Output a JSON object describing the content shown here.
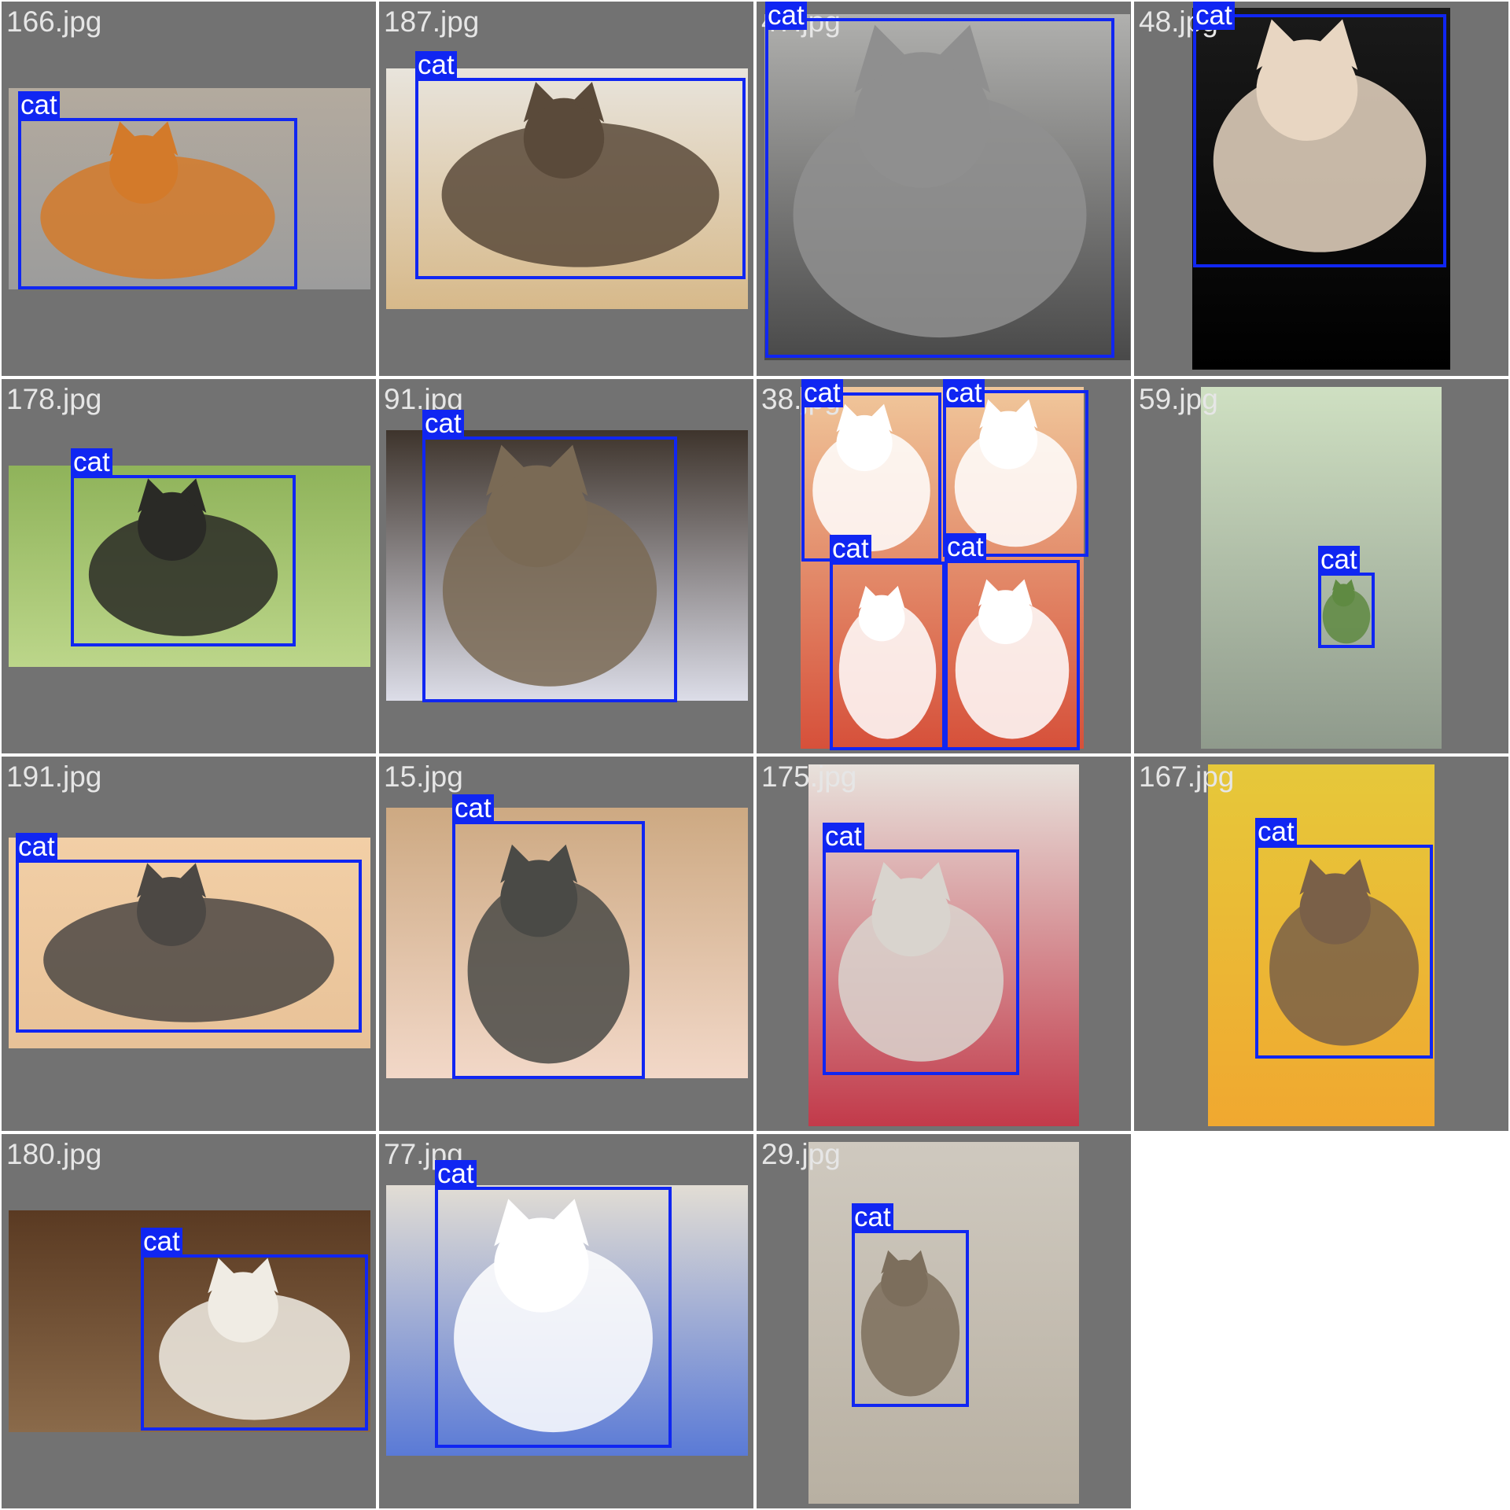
{
  "detection_class": "cat",
  "colors": {
    "tile_background": "#727272",
    "box_and_tag": "#1026f2",
    "tag_text": "#ffffff",
    "filename_text": "#e6e6e6"
  },
  "tiles": [
    {
      "file": "166.jpg",
      "scene": "orange tabby sleeping on grey mat",
      "palette": [
        "#b3aa9e",
        "#d37a2a",
        "#9c9c9c"
      ],
      "detections": [
        {
          "label": "cat"
        }
      ]
    },
    {
      "file": "187.jpg",
      "scene": "tortoiseshell persian lying on wooden floor",
      "palette": [
        "#e8e4dc",
        "#5a4a3a",
        "#d7b98a"
      ],
      "detections": [
        {
          "label": "cat"
        }
      ]
    },
    {
      "file": "47.jpg",
      "scene": "grey and white kitten in a dark hood",
      "palette": [
        "#b0b0ae",
        "#8f8f8f",
        "#494949"
      ],
      "detections": [
        {
          "label": "cat"
        }
      ]
    },
    {
      "file": "48.jpg",
      "scene": "cream kitten held up in hands",
      "palette": [
        "#1a1a1a",
        "#e8d6c2",
        "#000000"
      ],
      "detections": [
        {
          "label": "cat"
        }
      ]
    },
    {
      "file": "178.jpg",
      "scene": "black long-haired cat in grass",
      "palette": [
        "#8fb35a",
        "#2a2a26",
        "#bcd68a"
      ],
      "detections": [
        {
          "label": "cat"
        }
      ]
    },
    {
      "file": "91.jpg",
      "scene": "brown tabby from behind on blanket",
      "palette": [
        "#3e342c",
        "#7a6a55",
        "#dcdde8"
      ],
      "detections": [
        {
          "label": "cat"
        }
      ]
    },
    {
      "file": "38.jpg",
      "scene": "four cat selfies collage",
      "palette": [
        "#f0c79b",
        "#ffffff",
        "#d6503a"
      ],
      "detections": [
        {
          "label": "cat"
        },
        {
          "label": "cat"
        },
        {
          "label": "cat"
        },
        {
          "label": "cat"
        }
      ]
    },
    {
      "file": "59.jpg",
      "scene": "tiny kitten on a tiled roof under leaves",
      "palette": [
        "#cfe0c2",
        "#5f8a42",
        "#8f9a8c"
      ],
      "detections": [
        {
          "label": "cat"
        }
      ]
    },
    {
      "file": "191.jpg",
      "scene": "maine coon lying on beige backdrop",
      "palette": [
        "#f2cfa6",
        "#4c4844",
        "#e8c298"
      ],
      "detections": [
        {
          "label": "cat"
        }
      ]
    },
    {
      "file": "15.jpg",
      "scene": "grey tabby beside a pointing hand",
      "palette": [
        "#cda982",
        "#4a4a46",
        "#f2d8c8"
      ],
      "detections": [
        {
          "label": "cat"
        }
      ]
    },
    {
      "file": "175.jpg",
      "scene": "white long-haired cat looking up, flowers",
      "palette": [
        "#e8e2dc",
        "#d9d4ce",
        "#c23a4a"
      ],
      "detections": [
        {
          "label": "cat"
        }
      ]
    },
    {
      "file": "167.jpg",
      "scene": "tabby kitten among yellow flowers",
      "palette": [
        "#e6c83a",
        "#7a6048",
        "#f0a830"
      ],
      "detections": [
        {
          "label": "cat"
        }
      ]
    },
    {
      "file": "180.jpg",
      "scene": "calico long-haired cat on wooden bar",
      "palette": [
        "#5a3a22",
        "#f0ece4",
        "#8a6a4a"
      ],
      "detections": [
        {
          "label": "cat"
        }
      ]
    },
    {
      "file": "77.jpg",
      "scene": "white cat upside down on tile floor",
      "palette": [
        "#e2ddd4",
        "#ffffff",
        "#5a7ad6"
      ],
      "detections": [
        {
          "label": "cat"
        }
      ]
    },
    {
      "file": "29.jpg",
      "scene": "small tabby kitten sitting on pavement",
      "palette": [
        "#cfc9bf",
        "#7c6e5c",
        "#b8b0a2"
      ],
      "detections": [
        {
          "label": "cat"
        }
      ]
    }
  ]
}
